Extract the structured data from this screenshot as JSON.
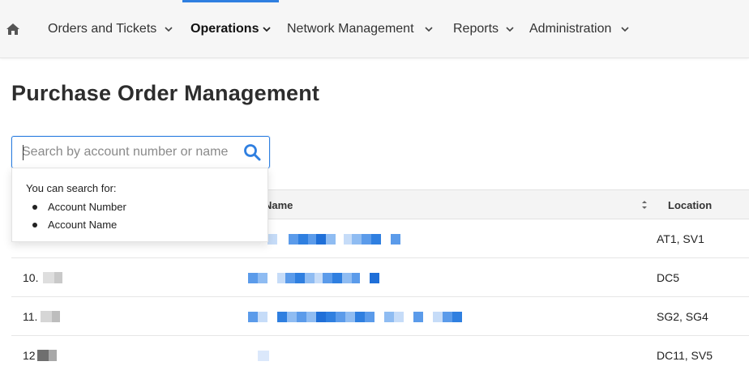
{
  "nav": {
    "home_icon": "home-icon",
    "items": [
      {
        "label": "Orders and Tickets"
      },
      {
        "label": "Operations"
      },
      {
        "label": "Network Management"
      },
      {
        "label": "Reports"
      },
      {
        "label": "Administration"
      }
    ],
    "active": "Operations"
  },
  "page": {
    "title": "Purchase Order Management"
  },
  "search": {
    "placeholder": "Search by account number or name",
    "value": ""
  },
  "popover": {
    "heading": "You can search for:",
    "items": [
      "Account Number",
      "Account Name"
    ]
  },
  "table": {
    "columns": [
      "Name",
      "Location"
    ],
    "rows": [
      {
        "id": "",
        "location": "AT1, SV1"
      },
      {
        "id": "10",
        "location": "DC5"
      },
      {
        "id": "11",
        "location": "SG2, SG4"
      },
      {
        "id": "12",
        "location": "DC11, SV5"
      }
    ]
  },
  "colors": {
    "accent": "#2f7fe0",
    "nav_bg": "#f6f6f6",
    "header_bg": "#f4f4f4"
  }
}
